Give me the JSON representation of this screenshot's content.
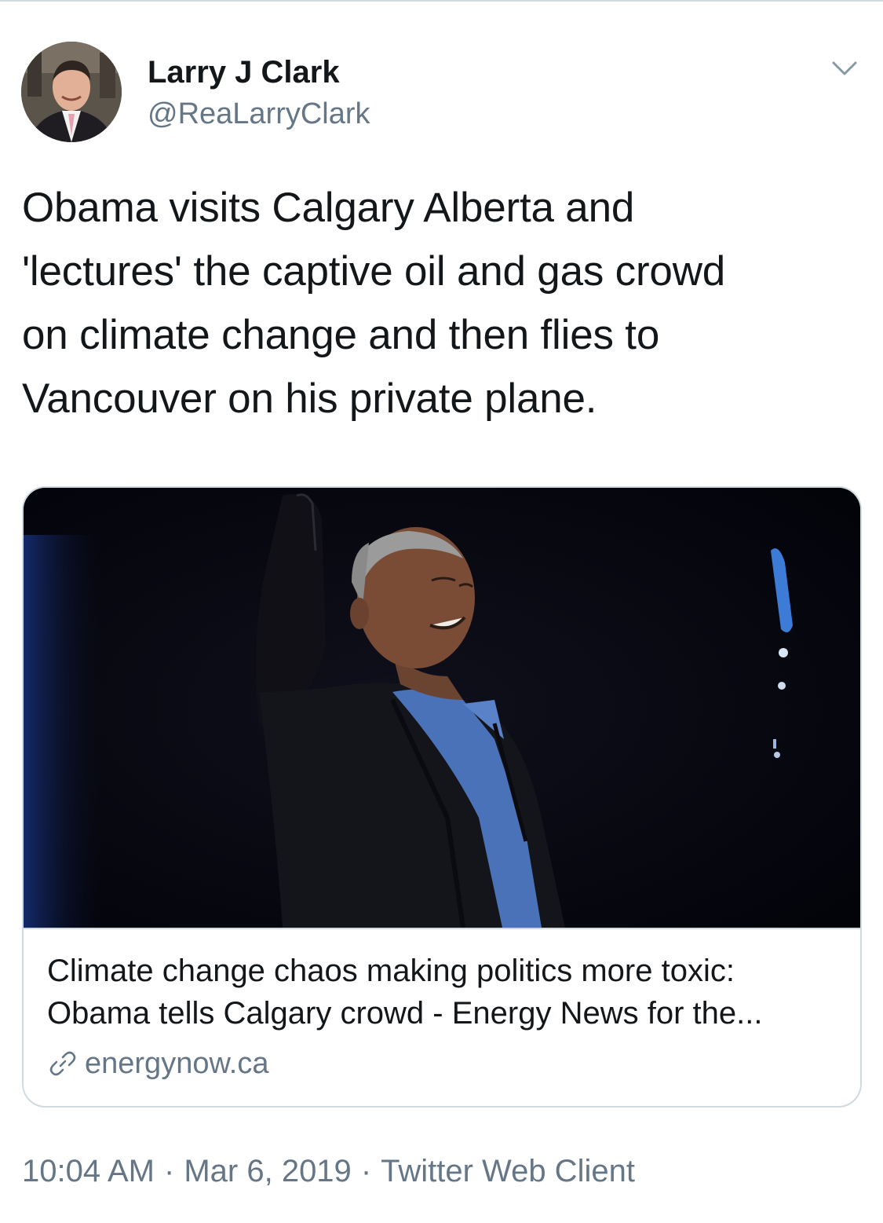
{
  "author": {
    "name": "Larry J Clark",
    "handle": "@ReaLarryClark"
  },
  "tweet": {
    "lines": [
      "Obama visits Calgary Alberta and",
      "'lectures' the captive oil and gas crowd",
      "on climate change and then flies to",
      "Vancouver on his private plane."
    ]
  },
  "card": {
    "title_lines": [
      "Climate change chaos making politics more toxic:",
      "Obama tells Calgary crowd - Energy News for the..."
    ],
    "domain": "energynow.ca",
    "icon": "link-icon"
  },
  "meta": {
    "time": "10:04 AM",
    "date": "Mar 6, 2019",
    "source": "Twitter Web Client",
    "separator": "·"
  },
  "icons": {
    "caret": "chevron-down-icon"
  },
  "colors": {
    "text": "#14171a",
    "secondary": "#657786",
    "border": "#cfd9de"
  }
}
